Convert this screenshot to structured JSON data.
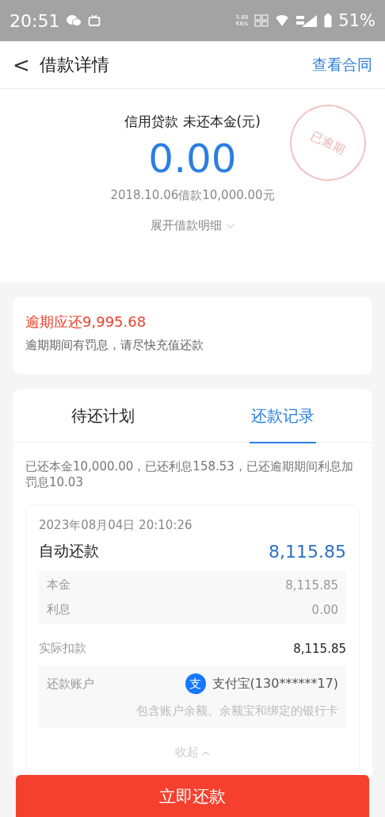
{
  "status_bar": {
    "time": "20:51",
    "speed": "5.69",
    "speed_unit": "KB/s",
    "battery": "51%"
  },
  "header": {
    "title": "借款详情",
    "back": "<",
    "action": "查看合同"
  },
  "summary": {
    "label": "信用贷款 未还本金(元)",
    "amount": "0.00",
    "loan_info": "2018.10.06借款10,000.00元",
    "expand": "展开借款明细",
    "stamp": "已逾期"
  },
  "overdue": {
    "title": "逾期应还9,995.68",
    "note": "逾期期间有罚息，请尽快充值还款"
  },
  "tabs": [
    {
      "label": "待还计划",
      "selected": false
    },
    {
      "label": "还款记录",
      "selected": true
    }
  ],
  "repaid_note": "已还本金10,000.00，已还利息158.53，已还逾期期间利息加罚息10.03",
  "record": {
    "datetime": "2023年08月04日 20:10:26",
    "type": "自动还款",
    "amount": "8,115.85",
    "breakdown": [
      {
        "label": "本金",
        "value": "8,115.85"
      },
      {
        "label": "利息",
        "value": "0.00"
      }
    ],
    "deducted_label": "实际扣款",
    "deducted_value": "8,115.85",
    "account_label": "还款账户",
    "account_icon": "支",
    "account": "支付宝(130******17)",
    "account_note": "包含账户余额、余额宝和绑定的银行卡",
    "collapse": "收起"
  },
  "pay_button": "立即还款"
}
